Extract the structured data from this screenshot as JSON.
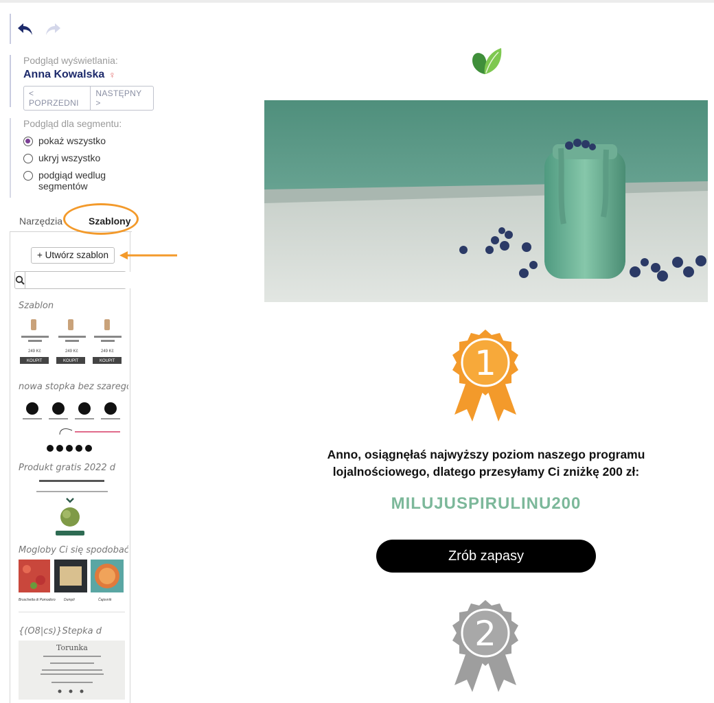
{
  "history": {
    "undo_icon": "undo-icon",
    "redo_icon": "redo-icon"
  },
  "preview": {
    "label": "Podgląd wyświetlania:",
    "person_name": "Anna Kowalska",
    "person_icon": "person-icon",
    "prev_label": "< POPRZEDNI",
    "next_label": "NASTĘPNY >"
  },
  "segment": {
    "label": "Podgląd dla segmentu:",
    "options": [
      {
        "label": "pokaż wszystko",
        "selected": true
      },
      {
        "label": "ukryj wszystko",
        "selected": false
      },
      {
        "label": "podgiąd wedlug segmentów",
        "selected": false
      }
    ]
  },
  "tabs": [
    {
      "label": "Narzędzia",
      "active": false
    },
    {
      "label": "Szablony",
      "active": true
    }
  ],
  "templates_panel": {
    "create_label": "+ Utwórz szablon",
    "search_placeholder": "",
    "items": [
      {
        "title": "Szablon",
        "prices": [
          "249 Kč",
          "249 Kč",
          "249 Kč"
        ],
        "button": "KOUPIT"
      },
      {
        "title": "nowa stopka bez szarego d"
      },
      {
        "title": "Produkt gratis 2022 d"
      },
      {
        "title": "Mogloby Ci się spodobać d",
        "captions": [
          "Bruschetta di Pomodoro",
          "Dumpli",
          "Čajovník"
        ]
      },
      {
        "title": "{(O8|cs)}Stepka d",
        "brand": "Torunka"
      }
    ]
  },
  "email": {
    "logo_icon": "leaf-logo-icon",
    "hero_alt": "green smoothie jar with blueberries",
    "medal_1": "1",
    "promo_text_line1": "Anno, osiągnęłaś najwyższy poziom naszego programu",
    "promo_text_line2": "lojalnościowego, dlatego przesyłamy Ci zniżkę 200 zł:",
    "promo_code": "MILUJUSPIRULINU200",
    "cta_label": "Zrób zapasy",
    "medal_2": "2"
  },
  "colors": {
    "accent_orange": "#f39a2b",
    "brand_navy": "#1d2a6b",
    "code_green": "#7cb89a",
    "radio_purple": "#7b3f94"
  }
}
